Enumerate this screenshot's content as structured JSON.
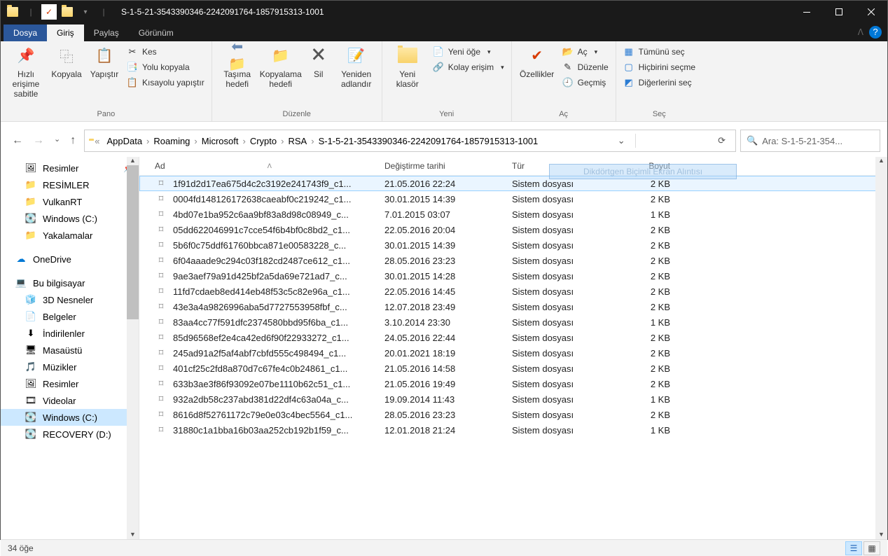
{
  "window": {
    "title": "S-1-5-21-3543390346-2242091764-1857915313-1001"
  },
  "tabs": {
    "file": "Dosya",
    "home": "Giriş",
    "share": "Paylaş",
    "view": "Görünüm"
  },
  "ribbon": {
    "pano": {
      "label": "Pano",
      "pin": "Hızlı erişime sabitle",
      "copy": "Kopyala",
      "paste": "Yapıştır",
      "cut": "Kes",
      "copypath": "Yolu kopyala",
      "pasteshortcut": "Kısayolu yapıştır"
    },
    "duzen": {
      "label": "Düzenle",
      "move": "Taşıma hedefi",
      "copyto": "Kopyalama hedefi",
      "delete": "Sil",
      "rename": "Yeniden adlandır"
    },
    "yeni": {
      "label": "Yeni",
      "newfolder": "Yeni klasör",
      "newitem": "Yeni öğe",
      "easyaccess": "Kolay erişim"
    },
    "ac": {
      "label": "Aç",
      "props": "Özellikler",
      "open": "Aç",
      "edit": "Düzenle",
      "history": "Geçmiş"
    },
    "sec": {
      "label": "Seç",
      "selectall": "Tümünü seç",
      "selectnone": "Hiçbirini seçme",
      "invert": "Diğerlerini seç"
    }
  },
  "breadcrumb": [
    "AppData",
    "Roaming",
    "Microsoft",
    "Crypto",
    "RSA",
    "S-1-5-21-3543390346-2242091764-1857915313-1001"
  ],
  "search": {
    "placeholder": "Ara: S-1-5-21-354..."
  },
  "columns": {
    "name": "Ad",
    "date": "Değiştirme tarihi",
    "type": "Tür",
    "size": "Boyut"
  },
  "sidebar": {
    "items": [
      {
        "label": "Resimler",
        "icon": "picture",
        "lvl": 1,
        "pin": true
      },
      {
        "label": "RESİMLER",
        "icon": "folder",
        "lvl": 1,
        "pin": false
      },
      {
        "label": "VulkanRT",
        "icon": "folder",
        "lvl": 1,
        "pin": false
      },
      {
        "label": "Windows (C:)",
        "icon": "drive",
        "lvl": 1,
        "pin": false
      },
      {
        "label": "Yakalamalar",
        "icon": "folder",
        "lvl": 1,
        "pin": false
      },
      {
        "gap": true
      },
      {
        "label": "OneDrive",
        "icon": "cloud",
        "lvl": 0,
        "pin": false
      },
      {
        "gap": true
      },
      {
        "label": "Bu bilgisayar",
        "icon": "pc",
        "lvl": 0,
        "pin": false
      },
      {
        "label": "3D Nesneler",
        "icon": "3d",
        "lvl": 1,
        "pin": false
      },
      {
        "label": "Belgeler",
        "icon": "doc",
        "lvl": 1,
        "pin": false
      },
      {
        "label": "İndirilenler",
        "icon": "download",
        "lvl": 1,
        "pin": false
      },
      {
        "label": "Masaüstü",
        "icon": "desktop",
        "lvl": 1,
        "pin": false
      },
      {
        "label": "Müzikler",
        "icon": "music",
        "lvl": 1,
        "pin": false
      },
      {
        "label": "Resimler",
        "icon": "picture",
        "lvl": 1,
        "pin": false
      },
      {
        "label": "Videolar",
        "icon": "video",
        "lvl": 1,
        "pin": false
      },
      {
        "label": "Windows (C:)",
        "icon": "drive",
        "lvl": 1,
        "pin": false,
        "selected": true
      },
      {
        "label": "RECOVERY (D:)",
        "icon": "drive2",
        "lvl": 1,
        "pin": false
      }
    ]
  },
  "files": [
    {
      "name": "1f91d2d17ea675d4c2c3192e241743f9_c1...",
      "date": "21.05.2016 22:24",
      "type": "Sistem dosyası",
      "size": "2 KB",
      "selected": true
    },
    {
      "name": "0004fd148126172638caeabf0c219242_c1...",
      "date": "30.01.2015 14:39",
      "type": "Sistem dosyası",
      "size": "2 KB"
    },
    {
      "name": "4bd07e1ba952c6aa9bf83a8d98c08949_c...",
      "date": "7.01.2015 03:07",
      "type": "Sistem dosyası",
      "size": "1 KB"
    },
    {
      "name": "05dd622046991c7cce54f6b4bf0c8bd2_c1...",
      "date": "22.05.2016 20:04",
      "type": "Sistem dosyası",
      "size": "2 KB"
    },
    {
      "name": "5b6f0c75ddf61760bbca871e00583228_c...",
      "date": "30.01.2015 14:39",
      "type": "Sistem dosyası",
      "size": "2 KB"
    },
    {
      "name": "6f04aaade9c294c03f182cd2487ce612_c1...",
      "date": "28.05.2016 23:23",
      "type": "Sistem dosyası",
      "size": "2 KB"
    },
    {
      "name": "9ae3aef79a91d425bf2a5da69e721ad7_c...",
      "date": "30.01.2015 14:28",
      "type": "Sistem dosyası",
      "size": "2 KB"
    },
    {
      "name": "11fd7cdaeb8ed414eb48f53c5c82e96a_c1...",
      "date": "22.05.2016 14:45",
      "type": "Sistem dosyası",
      "size": "2 KB"
    },
    {
      "name": "43e3a4a9826996aba5d7727553958fbf_c...",
      "date": "12.07.2018 23:49",
      "type": "Sistem dosyası",
      "size": "2 KB"
    },
    {
      "name": "83aa4cc77f591dfc2374580bbd95f6ba_c1...",
      "date": "3.10.2014 23:30",
      "type": "Sistem dosyası",
      "size": "1 KB"
    },
    {
      "name": "85d96568ef2e4ca42ed6f90f22933272_c1...",
      "date": "24.05.2016 22:44",
      "type": "Sistem dosyası",
      "size": "2 KB"
    },
    {
      "name": "245ad91a2f5af4abf7cbfd555c498494_c1...",
      "date": "20.01.2021 18:19",
      "type": "Sistem dosyası",
      "size": "2 KB"
    },
    {
      "name": "401cf25c2fd8a870d7c67fe4c0b24861_c1...",
      "date": "21.05.2016 14:58",
      "type": "Sistem dosyası",
      "size": "2 KB"
    },
    {
      "name": "633b3ae3f86f93092e07be1110b62c51_c1...",
      "date": "21.05.2016 19:49",
      "type": "Sistem dosyası",
      "size": "2 KB"
    },
    {
      "name": "932a2db58c237abd381d22df4c63a04a_c...",
      "date": "19.09.2014 11:43",
      "type": "Sistem dosyası",
      "size": "1 KB"
    },
    {
      "name": "8616d8f52761172c79e0e03c4bec5564_c1...",
      "date": "28.05.2016 23:23",
      "type": "Sistem dosyası",
      "size": "2 KB"
    },
    {
      "name": "31880c1a1bba16b03aa252cb192b1f59_c...",
      "date": "12.01.2018 21:24",
      "type": "Sistem dosyası",
      "size": "1 KB"
    }
  ],
  "status": {
    "count": "34 öğe"
  },
  "snip": {
    "label": "Dikdörtgen Biçimli Ekran Alıntısı"
  },
  "icons": {
    "picture": "🖼",
    "folder": "📁",
    "drive": "💽",
    "drive2": "💽",
    "cloud": "☁",
    "pc": "💻",
    "3d": "🧊",
    "doc": "📄",
    "download": "⬇",
    "desktop": "🖥",
    "music": "🎵",
    "video": "🎞"
  }
}
